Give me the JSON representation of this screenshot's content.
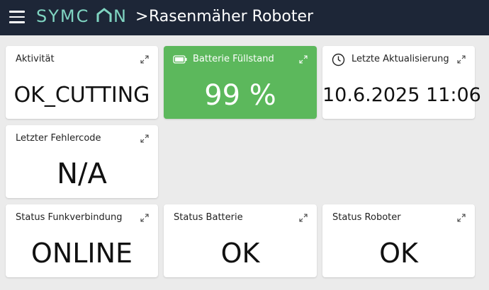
{
  "header": {
    "logo_text": "SYMCON",
    "breadcrumb_separator": ">",
    "title": "Rasenmäher Roboter",
    "logo_color": "#7fd4c1",
    "bg_color": "#1d2637"
  },
  "tiles": {
    "activity": {
      "title": "Aktivität",
      "value": "OK_CUTTING"
    },
    "battery_level": {
      "title": "Batterie Füllstand",
      "value": "99 %",
      "color": "#5cb85c",
      "icon": "battery-icon"
    },
    "last_update": {
      "title": "Letzte Aktualisierung",
      "value": "10.6.2025 11:06",
      "icon": "clock-icon"
    },
    "error_code": {
      "title": "Letzter Fehlercode",
      "value": "N/A"
    },
    "radio_status": {
      "title": "Status Funkverbindung",
      "value": "ONLINE"
    },
    "battery_status": {
      "title": "Status Batterie",
      "value": "OK"
    },
    "robot_status": {
      "title": "Status Roboter",
      "value": "OK"
    }
  }
}
